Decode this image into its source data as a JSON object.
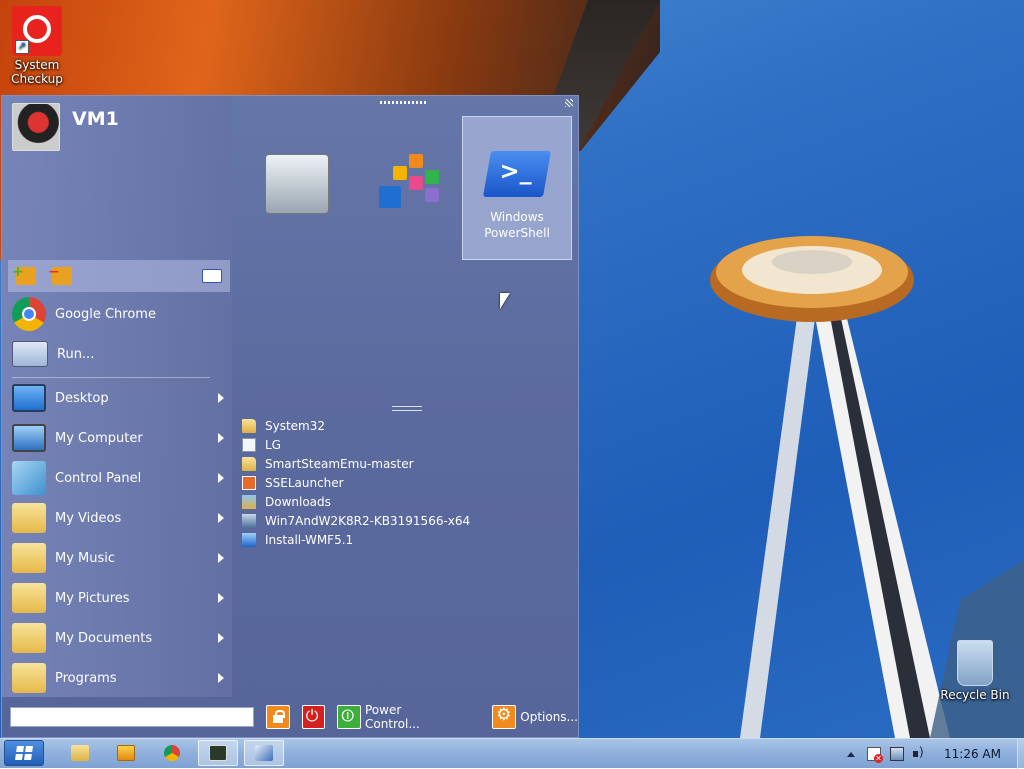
{
  "desktop": {
    "icons": [
      {
        "label": "System\nCheckup"
      },
      {
        "label": "Recycle Bin"
      }
    ]
  },
  "start_menu": {
    "user_name": "VM1",
    "pinned_tiles": [
      {
        "label": "",
        "icon": "toolbox-icon"
      },
      {
        "label": "",
        "icon": "tiles-app-icon"
      },
      {
        "label": "Windows\nPowerShell",
        "icon": "powershell-icon"
      }
    ],
    "menu_items": [
      {
        "label": "Google Chrome",
        "icon": "chrome-icon",
        "submenu": false
      },
      {
        "label": "Run...",
        "icon": "run-icon",
        "submenu": false
      },
      {
        "label": "Desktop",
        "icon": "desktop-icon",
        "submenu": true
      },
      {
        "label": "My Computer",
        "icon": "computer-icon",
        "submenu": true
      },
      {
        "label": "Control Panel",
        "icon": "control-panel-icon",
        "submenu": true
      },
      {
        "label": "My Videos",
        "icon": "folder-icon",
        "submenu": true
      },
      {
        "label": "My Music",
        "icon": "folder-icon",
        "submenu": true
      },
      {
        "label": "My Pictures",
        "icon": "folder-icon",
        "submenu": true
      },
      {
        "label": "My Documents",
        "icon": "folder-icon",
        "submenu": true
      },
      {
        "label": "Programs",
        "icon": "folder-icon",
        "submenu": true
      }
    ],
    "recent_items": [
      {
        "label": "System32",
        "icon": "folder-icon"
      },
      {
        "label": "LG",
        "icon": "file-icon"
      },
      {
        "label": "SmartSteamEmu-master",
        "icon": "folder-icon"
      },
      {
        "label": "SSELauncher",
        "icon": "feed-file-icon"
      },
      {
        "label": "Downloads",
        "icon": "downloads-folder-icon"
      },
      {
        "label": "Win7AndW2K8R2-KB3191566-x64",
        "icon": "installer-icon"
      },
      {
        "label": "Install-WMF5.1",
        "icon": "powershell-script-icon"
      }
    ],
    "search": {
      "value": "",
      "placeholder": ""
    },
    "bottom_bar": {
      "power_control_label": "Power Control...",
      "options_label": "Options..."
    }
  },
  "taskbar": {
    "clock": "11:26 AM"
  },
  "colors": {
    "menu_bg": "#5b6a9e",
    "taskbar": "#8fb0dc",
    "wallpaper_sky": "#2f6fc4"
  }
}
